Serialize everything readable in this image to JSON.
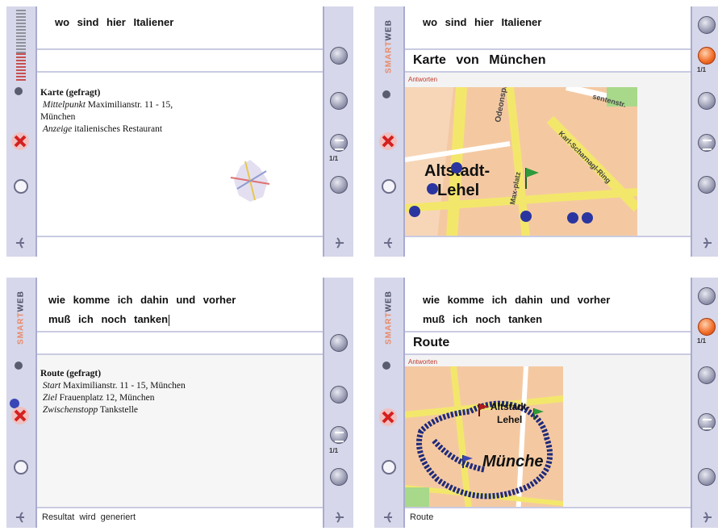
{
  "brand": {
    "smart": "SMART",
    "web": "WEB"
  },
  "panels": [
    {
      "query_line1": "wo sind hier Italiener",
      "query_line2": "",
      "title": "",
      "answers_label": "",
      "detail": {
        "heading": "Karte (gefragt)",
        "row1_key": "Mittelpunkt",
        "row1_val": "Maximilianstr. 11 - 15,",
        "row1b": "München",
        "row2_key": "Anzeige",
        "row2_val": "italienisches Restaurant",
        "row3_key": "",
        "row3_val": ""
      },
      "status": "",
      "page_indicator": "1/1"
    },
    {
      "query_line1": "wo sind hier Italiener",
      "query_line2": "",
      "title": "Karte von München",
      "answers_label": "Antworten",
      "map_labels": {
        "district": "Altstadt-",
        "district2": "Lehel",
        "s1": "Odeonspl.",
        "s2": "Max-platz",
        "s3": "Karl-Scharnagl-Ring",
        "s4": "sentenstr."
      },
      "status": "",
      "page_indicator": "1/1"
    },
    {
      "query_line1": "wie komme ich dahin und vorher",
      "query_line2": "muß ich noch tanken",
      "title": "",
      "answers_label": "",
      "detail": {
        "heading": "Route (gefragt)",
        "row1_key": "Start",
        "row1_val": "Maximilianstr. 11 - 15, München",
        "row1b": "",
        "row2_key": "Ziel",
        "row2_val": "Frauenplatz 12, München",
        "row3_key": "Zwischenstopp",
        "row3_val": "Tankstelle"
      },
      "status": "Resultat wird generiert",
      "page_indicator": "1/1"
    },
    {
      "query_line1": "wie komme ich dahin und vorher",
      "query_line2": "muß ich noch tanken",
      "title": "Route",
      "answers_label": "Antworten",
      "map_labels": {
        "district": "Altstadt-",
        "district2": "Lehel",
        "city": "Münche"
      },
      "status": "Route",
      "page_indicator": "1/1"
    }
  ],
  "colors": {
    "sidebar": "#d6d7ea",
    "accent": "#f06a24",
    "route": "#1f2a7a",
    "map_bg": "#f4c9a2",
    "road": "#f3e76b"
  },
  "icons": [
    "voice-meter-icon",
    "cancel-icon",
    "round-button-icon",
    "phone-icon",
    "camera-icon",
    "display-icon",
    "list-icon",
    "speaker-icon",
    "back-icon",
    "forward-icon"
  ]
}
